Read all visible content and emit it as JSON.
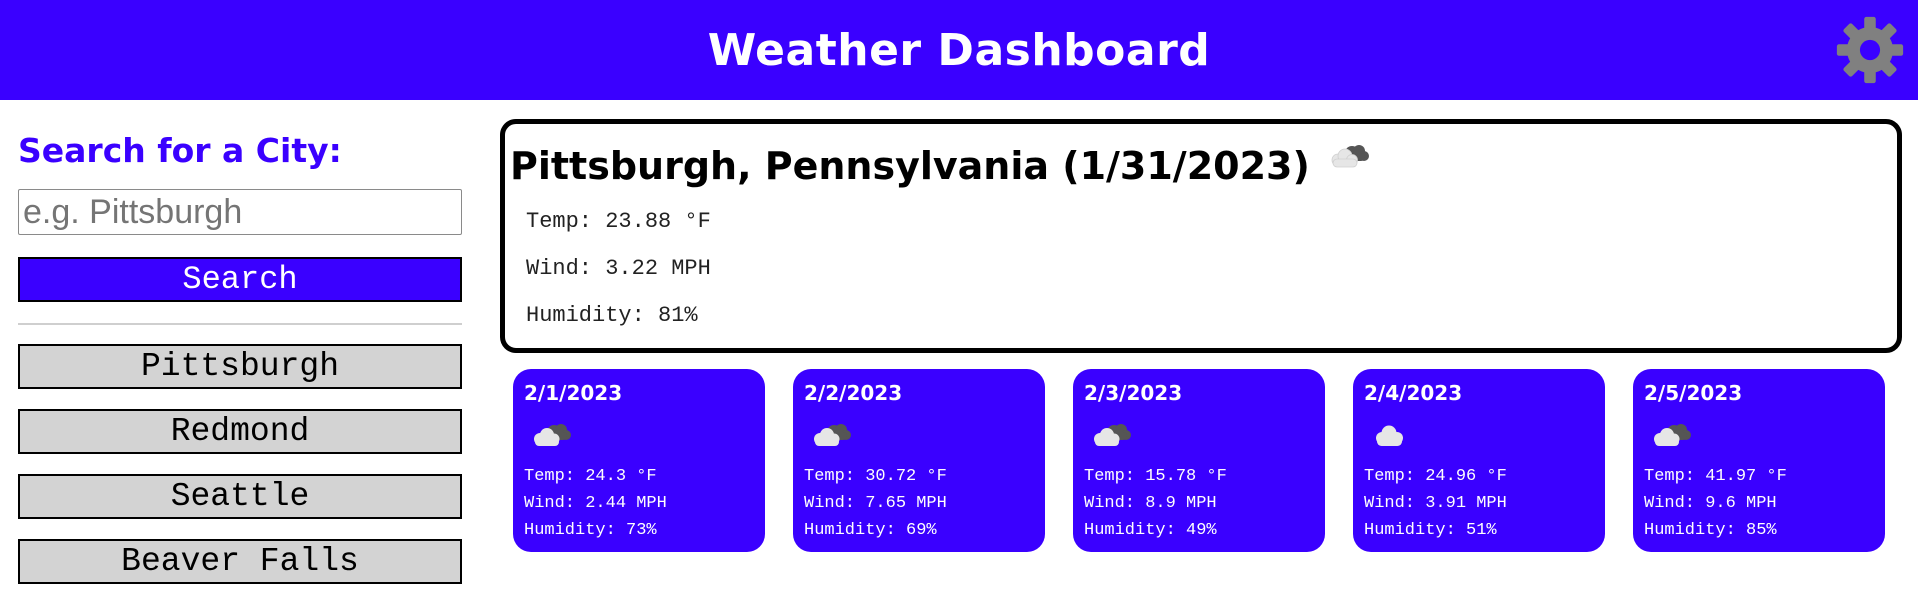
{
  "header": {
    "title": "Weather Dashboard",
    "settings_icon": "gear-icon"
  },
  "sidebar": {
    "heading": "Search for a City:",
    "search_placeholder": "e.g. Pittsburgh",
    "search_button": "Search",
    "history": [
      "Pittsburgh",
      "Redmond",
      "Seattle",
      "Beaver Falls"
    ]
  },
  "current": {
    "title": "Pittsburgh, Pennsylvania (1/31/2023)",
    "icon": "cloud-icon",
    "temp": "Temp: 23.88 °F",
    "wind": "Wind: 3.22 MPH",
    "humidity": "Humidity: 81%"
  },
  "forecast": [
    {
      "date": "2/1/2023",
      "icon": "cloud-icon",
      "temp": "Temp: 24.3 °F",
      "wind": "Wind: 2.44 MPH",
      "humidity": "Humidity: 73%"
    },
    {
      "date": "2/2/2023",
      "icon": "cloud-icon",
      "temp": "Temp: 30.72 °F",
      "wind": "Wind: 7.65 MPH",
      "humidity": "Humidity: 69%"
    },
    {
      "date": "2/3/2023",
      "icon": "cloud-icon",
      "temp": "Temp: 15.78 °F",
      "wind": "Wind: 8.9 MPH",
      "humidity": "Humidity: 49%"
    },
    {
      "date": "2/4/2023",
      "icon": "cloud-icon",
      "temp": "Temp: 24.96 °F",
      "wind": "Wind: 3.91 MPH",
      "humidity": "Humidity: 51%"
    },
    {
      "date": "2/5/2023",
      "icon": "cloud-icon",
      "temp": "Temp: 41.97 °F",
      "wind": "Wind: 9.6 MPH",
      "humidity": "Humidity: 85%"
    }
  ],
  "colors": {
    "brand": "#3a00ff",
    "history_button": "#d3d3d3",
    "settings_icon": "#808080"
  }
}
